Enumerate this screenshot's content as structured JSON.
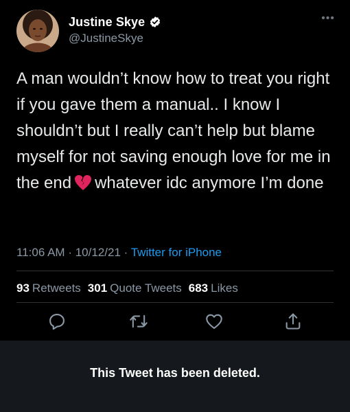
{
  "author": {
    "display_name": "Justine Skye",
    "handle": "@JustineSkye",
    "verified": true
  },
  "tweet": {
    "text_before_emoji": "A man wouldn’t know how to treat you right if you gave them a manual.. I know I shouldn’t but I really can’t help but blame myself for not saving enough love for me in the end",
    "emoji": "broken-heart-icon",
    "text_after_emoji": "whatever idc anymore I’m done",
    "time": "11:06 AM",
    "separator": "·",
    "date": "10/12/21",
    "source": "Twitter for iPhone"
  },
  "stats": {
    "retweets_count": "93",
    "retweets_label": "Retweets",
    "quote_count": "301",
    "quote_label": "Quote Tweets",
    "likes_count": "683",
    "likes_label": "Likes"
  },
  "actions": [
    "reply-icon",
    "retweet-icon",
    "like-icon",
    "share-icon"
  ],
  "deleted_notice": "This Tweet has been deleted.",
  "colors": {
    "background": "#000000",
    "text": "#e7e9ea",
    "secondary": "#8b98a5",
    "link": "#1d9bf0",
    "divider": "#2f3336",
    "deleted_bg": "#15181c"
  }
}
